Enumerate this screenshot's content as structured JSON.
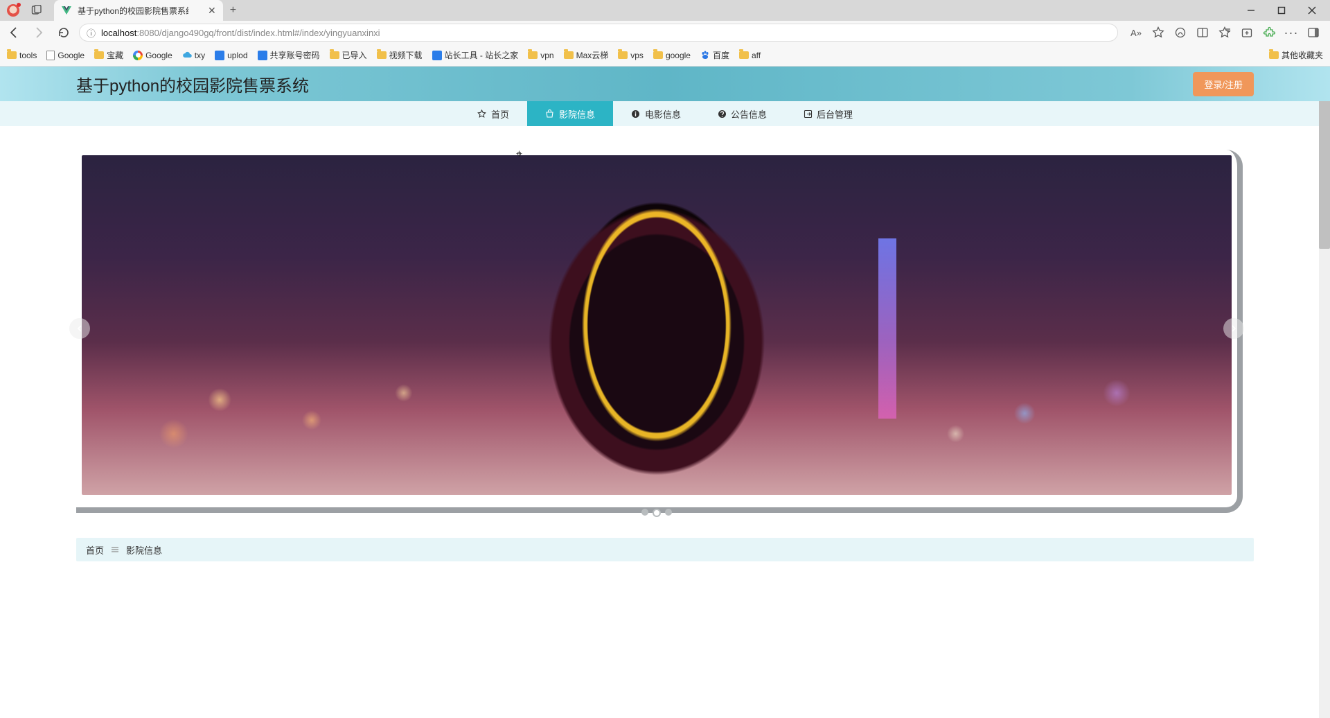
{
  "window": {
    "tab_title": "基于python的校园影院售票系统",
    "new_tab": "+",
    "min": "—",
    "max": "▢",
    "close": "✕"
  },
  "url": {
    "info_prefix": "ⓘ",
    "host": "localhost",
    "rest": ":8080/django490gq/front/dist/index.html#/index/yingyuanxinxi",
    "zoom_badge": "A»"
  },
  "bookmarks": {
    "items": [
      {
        "icon": "folder",
        "label": "tools"
      },
      {
        "icon": "page",
        "label": "Google"
      },
      {
        "icon": "folder",
        "label": "宝藏"
      },
      {
        "icon": "google",
        "label": "Google"
      },
      {
        "icon": "txy",
        "label": "txy"
      },
      {
        "icon": "blue",
        "label": "uplod"
      },
      {
        "icon": "blue",
        "label": "共享账号密码"
      },
      {
        "icon": "folder",
        "label": "已导入"
      },
      {
        "icon": "folder",
        "label": "视频下载"
      },
      {
        "icon": "blue",
        "label": "站长工具 - 站长之家"
      },
      {
        "icon": "folder",
        "label": "vpn"
      },
      {
        "icon": "folder",
        "label": "Max云梯"
      },
      {
        "icon": "folder",
        "label": "vps"
      },
      {
        "icon": "folder",
        "label": "google"
      },
      {
        "icon": "baidu",
        "label": "百度"
      },
      {
        "icon": "folder",
        "label": "aff"
      }
    ],
    "other": "其他收藏夹"
  },
  "header": {
    "site_title": "基于python的校园影院售票系统",
    "login_button": "登录/注册"
  },
  "nav": {
    "items": [
      {
        "icon": "star",
        "label": "首页",
        "active": false
      },
      {
        "icon": "shop",
        "label": "影院信息",
        "active": true
      },
      {
        "icon": "info",
        "label": "电影信息",
        "active": false
      },
      {
        "icon": "question",
        "label": "公告信息",
        "active": false
      },
      {
        "icon": "arrow-out",
        "label": "后台管理",
        "active": false
      }
    ]
  },
  "carousel": {
    "slide_alt": "hooded figure against neon city skyline",
    "dot_count": 3,
    "active_dot": 1
  },
  "breadcrumb": {
    "home": "首页",
    "current": "影院信息"
  }
}
